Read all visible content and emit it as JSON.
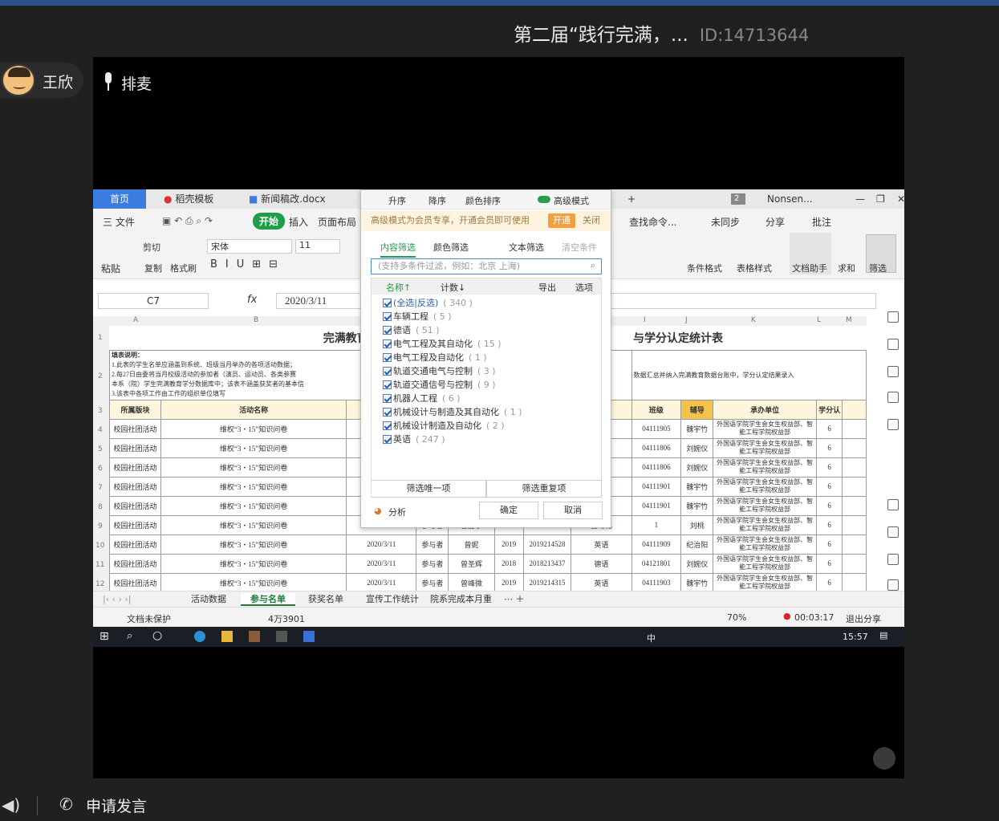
{
  "meeting": {
    "title": "第二届“践行完满，...",
    "id": "ID:14713644",
    "user": "王欣",
    "paimai": "排麦",
    "apply_speak": "申请发言"
  },
  "tabs": {
    "home": "首页",
    "t1": "稻壳模板",
    "t2": "新闻稿改.docx",
    "badge": "2",
    "user": "Nonsen..."
  },
  "menu": {
    "file": "三 文件",
    "start": "开始",
    "insert": "插入",
    "layout": "页面布局",
    "find": "查找命令...",
    "sync": "未同步",
    "share": "分享",
    "comment": "批注"
  },
  "ribbon": {
    "paste": "粘贴",
    "cut": "剪切",
    "copy": "复制",
    "format_painter": "格式刷",
    "font": "宋体",
    "size": "11",
    "cond_format": "条件格式",
    "table_style": "表格样式",
    "doc_helper": "文档助手",
    "sum": "求和",
    "filter": "筛选"
  },
  "formula": {
    "cell": "C7",
    "fx": "fx",
    "value": "2020/3/11"
  },
  "cols": [
    "A",
    "B",
    "",
    "",
    "",
    "",
    "",
    "",
    "I",
    "J",
    "K",
    "L",
    "M"
  ],
  "rows": [
    "1",
    "2",
    "3",
    "4",
    "5",
    "6",
    "7",
    "8",
    "9",
    "10",
    "11",
    "12"
  ],
  "sheet": {
    "title_left": "完满教育委员会外国语学",
    "title_right": "与学分认定统计表",
    "note1": "填表说明：",
    "note2": "1.此表的学生名单应涵盖到系统、班级当月举办的各项活动数据；",
    "note3": "2.每27日由委将当月校级活动的参加者（演员、运动员、各类参赛",
    "note4": "本系（院）学生完满教育学分数据库中；该表不涵盖获奖者的基本信",
    "note5": "3.该表中各项工作由工作的组织单位填写",
    "note_right": "数据汇总并纳入完满教育数据台账中，学分认定结果录入",
    "headers": {
      "a": "所属版块",
      "b": "活动名称",
      "i": "班级",
      "j": "辅导",
      "k": "承办单位",
      "l": "学分认"
    },
    "rows": [
      {
        "a": "校园社团活动",
        "b": "维权“3・15”知识问卷",
        "date": "",
        "role": "",
        "name": "",
        "year": "",
        "sid": "",
        "major": "",
        "cls": "04111905",
        "tutor": "魏宇竹",
        "unit": "外国语学院学生会女生权益部、智能工程学院权益部",
        "credit": "6"
      },
      {
        "a": "校园社团活动",
        "b": "维权“3・15”知识问卷",
        "date": "",
        "role": "",
        "name": "",
        "year": "",
        "sid": "",
        "major": "",
        "cls": "04111806",
        "tutor": "刘婉仪",
        "unit": "外国语学院学生会女生权益部、智能工程学院权益部",
        "credit": "6"
      },
      {
        "a": "校园社团活动",
        "b": "维权“3・15”知识问卷",
        "date": "",
        "role": "",
        "name": "",
        "year": "",
        "sid": "",
        "major": "",
        "cls": "04111806",
        "tutor": "刘婉仪",
        "unit": "外国语学院学生会女生权益部、智能工程学院权益部",
        "credit": "6"
      },
      {
        "a": "校园社团活动",
        "b": "维权“3・15”知识问卷",
        "date": "",
        "role": "",
        "name": "",
        "year": "",
        "sid": "",
        "major": "",
        "cls": "04111901",
        "tutor": "魏宇竹",
        "unit": "外国语学院学生会女生权益部、智能工程学院权益部",
        "credit": "6"
      },
      {
        "a": "校园社团活动",
        "b": "维权“3・15”知识问卷",
        "date": "",
        "role": "",
        "name": "",
        "year": "",
        "sid": "",
        "major": "",
        "cls": "04111901",
        "tutor": "魏宇竹",
        "unit": "外国语学院学生会女生权益部、智能工程学院权益部",
        "credit": "6"
      },
      {
        "a": "校园社团活动",
        "b": "维权“3・15”知识问卷",
        "date": "2020/3/11",
        "role": "参与者",
        "name": "曾嘉宇",
        "year": "2019",
        "sid": "2019213611",
        "major": "自动化",
        "cls": "1",
        "tutor": "刘桃",
        "unit": "外国语学院学生会女生权益部、智能工程学院权益部",
        "credit": "6"
      },
      {
        "a": "校园社团活动",
        "b": "维权“3・15”知识问卷",
        "date": "2020/3/11",
        "role": "参与者",
        "name": "曾妮",
        "year": "2019",
        "sid": "2019214528",
        "major": "英语",
        "cls": "04111909",
        "tutor": "纪治阳",
        "unit": "外国语学院学生会女生权益部、智能工程学院权益部",
        "credit": "6"
      },
      {
        "a": "校园社团活动",
        "b": "维权“3・15”知识问卷",
        "date": "2020/3/11",
        "role": "参与者",
        "name": "曾圣辉",
        "year": "2018",
        "sid": "2018213437",
        "major": "德语",
        "cls": "04121801",
        "tutor": "刘婉仪",
        "unit": "外国语学院学生会女生权益部、智能工程学院权益部",
        "credit": "6"
      },
      {
        "a": "校园社团活动",
        "b": "维权“3・15”知识问卷",
        "date": "2020/3/11",
        "role": "参与者",
        "name": "曾峰微",
        "year": "2019",
        "sid": "2019214315",
        "major": "英语",
        "cls": "04111903",
        "tutor": "魏宇竹",
        "unit": "外国语学院学生会女生权益部、智能工程学院权益部",
        "credit": "6"
      }
    ]
  },
  "dropdown": {
    "asc": "升序",
    "desc": "降序",
    "color_sort": "颜色排序",
    "adv_mode": "高级模式",
    "promo": "高级模式为会员专享，开通会员即可使用",
    "open": "开通",
    "close": "关闭",
    "tab_content": "内容筛选",
    "tab_color": "颜色筛选",
    "text_filter": "文本筛选",
    "clear": "清空条件",
    "placeholder": "(支持多条件过滤，例如：北京 上海)",
    "hdr_name": "名称↑",
    "hdr_count": "计数↓",
    "export": "导出",
    "options": "选项",
    "items": [
      {
        "label": "(全选|反选)",
        "count": "( 340 )"
      },
      {
        "label": "车辆工程",
        "count": "( 5 )"
      },
      {
        "label": "德语",
        "count": "( 51 )"
      },
      {
        "label": "电气工程及其自动化",
        "count": "( 15 )"
      },
      {
        "label": "电气工程及自动化",
        "count": "( 1 )"
      },
      {
        "label": "轨道交通电气与控制",
        "count": "( 3 )"
      },
      {
        "label": "轨道交通信号与控制",
        "count": "( 9 )"
      },
      {
        "label": "机器人工程",
        "count": "( 6 )"
      },
      {
        "label": "机械设计与制造及其自动化",
        "count": "( 1 )"
      },
      {
        "label": "机械设计制造及自动化",
        "count": "( 2 )"
      },
      {
        "label": "英语",
        "count": "( 247 )"
      }
    ],
    "unique": "筛选唯一项",
    "dup": "筛选重复项",
    "analyze": "分析",
    "ok": "确定",
    "cancel": "取消"
  },
  "sheet_tabs": [
    "活动数据",
    "参与名单",
    "获奖名单",
    "宣传工作统计",
    "院系完成本月重"
  ],
  "status": {
    "protect": "文档未保护",
    "count": "4万3901",
    "zoom": "70%",
    "timer": "00:03:17",
    "exit": "退出分享"
  },
  "taskbar": {
    "time": "15:57",
    "ime": "中"
  }
}
